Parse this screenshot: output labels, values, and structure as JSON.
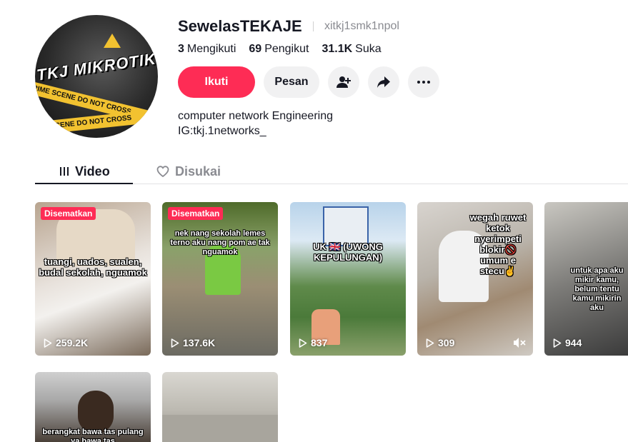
{
  "profile": {
    "username": "SewelasTEKAJE",
    "handle": "xitkj1smk1npol",
    "avatar_text": "TKJ MIKROTIK",
    "avatar_tape_1": "CRIME SCENE DO NOT CROSS",
    "avatar_tape_2": "CRIME SCENE DO NOT CROSS",
    "stats": [
      {
        "value": "3",
        "label": "Mengikuti"
      },
      {
        "value": "69",
        "label": "Pengikut"
      },
      {
        "value": "31.1K",
        "label": "Suka"
      }
    ],
    "bio_lines": [
      "computer network Engineering",
      "IG:tkj.1networks_"
    ]
  },
  "actions": {
    "follow_label": "Ikuti",
    "message_label": "Pesan",
    "add_user_icon": "person-plus-icon",
    "share_icon": "share-arrow-icon",
    "more_icon": "more-dots-icon"
  },
  "tabs": [
    {
      "label": "Video",
      "icon": "grid-bars-icon",
      "active": true
    },
    {
      "label": "Disukai",
      "icon": "heart-outline-icon",
      "active": false
    }
  ],
  "videos": [
    {
      "pinned": "Disematkan",
      "caption": "tuangi, uados, sualen, budal sekolah, nguamok",
      "views": "259.2K",
      "muted": false
    },
    {
      "pinned": "Disematkan",
      "caption": "nek nang sekolah lemes terno aku nang pom ae tak nguamok",
      "views": "137.6K",
      "muted": false
    },
    {
      "pinned": "",
      "caption": "UK 🇬🇧 (UWONG KEPULUNGAN)",
      "views": "837",
      "muted": false
    },
    {
      "pinned": "",
      "caption": "wegah ruwet ketok nyerimpeti blokir🚫 umum e stecu✌️",
      "views": "309",
      "muted": true
    },
    {
      "pinned": "",
      "caption": "untuk apa aku mikir kamu, belum tentu kamu mikirin aku",
      "views": "944",
      "muted": false
    },
    {
      "pinned": "",
      "caption": "berangkat bawa tas pulang ya bawa tas",
      "views": "",
      "muted": false
    },
    {
      "pinned": "",
      "caption": "",
      "views": "",
      "muted": false
    }
  ],
  "colors": {
    "accent": "#fe2c55",
    "text_primary": "#161823",
    "text_secondary": "#8a8b91",
    "button_bg": "#f1f1f2"
  }
}
